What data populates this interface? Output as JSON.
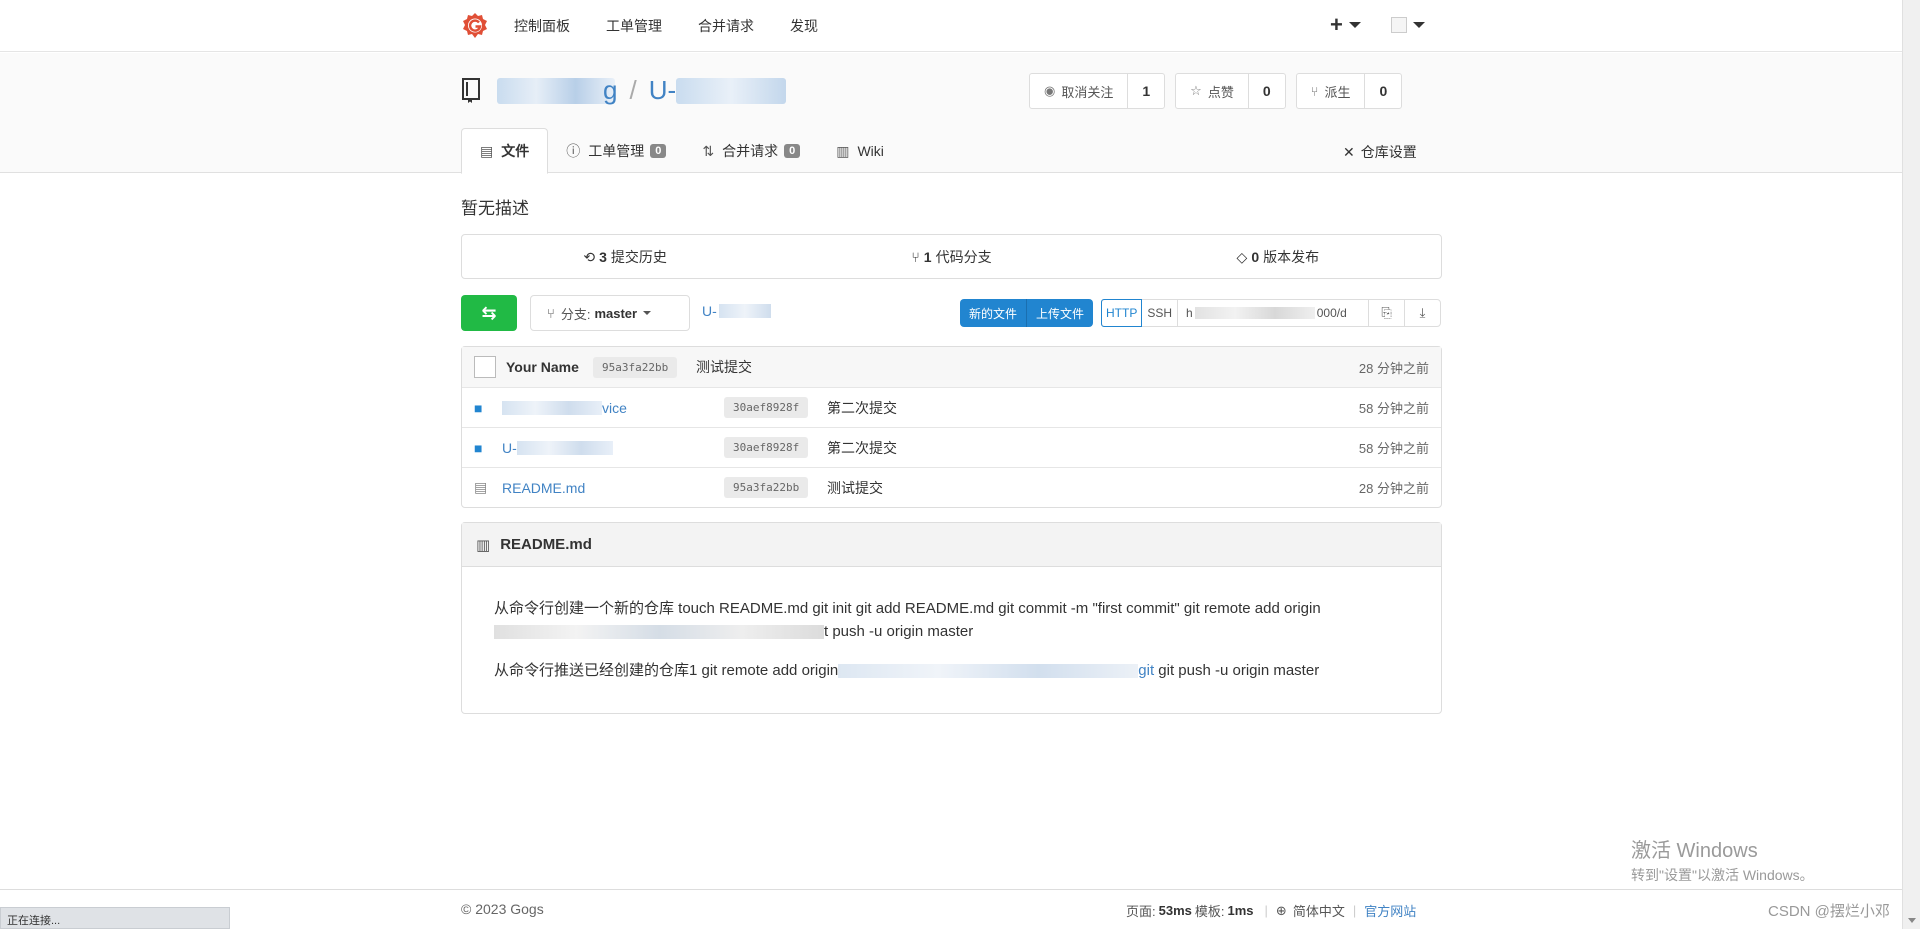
{
  "nav": {
    "items": [
      "控制面板",
      "工单管理",
      "合并请求",
      "发现"
    ],
    "plus": "+"
  },
  "repo": {
    "owner_tail": "g",
    "repo_prefix": "U-",
    "watch_label": "取消关注",
    "watch_count": "1",
    "star_label": "点赞",
    "star_count": "0",
    "fork_label": "派生",
    "fork_count": "0"
  },
  "tabs": {
    "files": "文件",
    "issues": "工单管理",
    "issues_count": "0",
    "pulls": "合并请求",
    "pulls_count": "0",
    "wiki": "Wiki",
    "settings": "仓库设置"
  },
  "description": "暂无描述",
  "stats": {
    "commits_count": "3",
    "commits_label": "提交历史",
    "branches_count": "1",
    "branches_label": "代码分支",
    "releases_count": "0",
    "releases_label": "版本发布"
  },
  "toolbar": {
    "branch_label": "分支:",
    "branch_name": "master",
    "crumb_prefix": "U-",
    "new_file": "新的文件",
    "upload_file": "上传文件",
    "http": "HTTP",
    "ssh": "SSH",
    "url_start": "h",
    "url_end": "000/d"
  },
  "latest_commit": {
    "author": "Your Name",
    "sha": "95a3fa22bb",
    "message": "测试提交",
    "time": "28 分钟之前"
  },
  "files": [
    {
      "name_tail": "vice",
      "sha": "30aef8928f",
      "message": "第二次提交",
      "time": "58 分钟之前",
      "type": "folder"
    },
    {
      "name_tail": "U-",
      "sha": "30aef8928f",
      "message": "第二次提交",
      "time": "58 分钟之前",
      "type": "folder"
    },
    {
      "name_tail": "README.md",
      "sha": "95a3fa22bb",
      "message": "测试提交",
      "time": "28 分钟之前",
      "type": "file"
    }
  ],
  "readme": {
    "title": "README.md",
    "line1": "从命令行创建一个新的仓库 touch README.md git init git add README.md git commit -m \"first commit\" git remote add origin",
    "line1b": "t push -u origin master",
    "line2a": "从命令行推送已经创建的仓库1 git remote add origin",
    "line2_link": "git",
    "line2b": " git push -u origin master"
  },
  "footer": {
    "copyright": "© 2023 Gogs",
    "page_label": "页面:",
    "page_time": "53ms",
    "tmpl_label": "模板:",
    "tmpl_time": "1ms",
    "language": "简体中文",
    "official": "官方网站"
  },
  "browser_status": "正在连接...",
  "os_overlay": {
    "line1": "激活 Windows",
    "line2": "转到\"设置\"以激活 Windows。"
  },
  "watermark": "CSDN @摆烂小邓",
  "colors": {
    "accent": "#2185d0",
    "green": "#21ba45",
    "link": "#4183c4",
    "logo": "#e04f36"
  }
}
